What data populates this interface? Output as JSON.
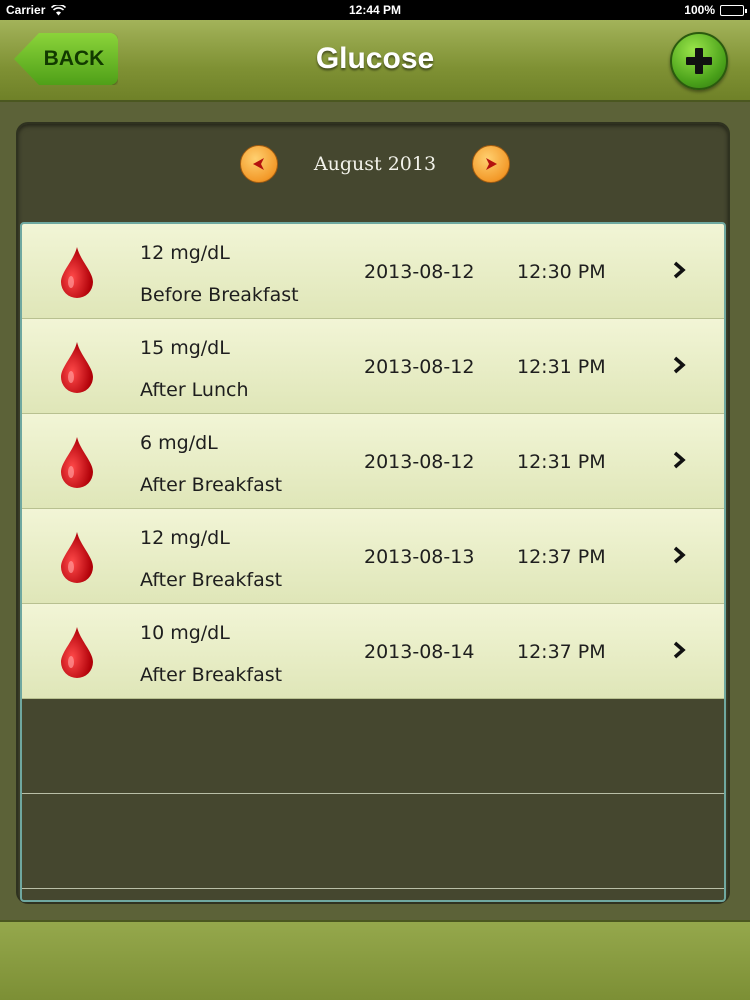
{
  "status_bar": {
    "carrier": "Carrier",
    "time": "12:44 PM",
    "battery": "100%"
  },
  "nav": {
    "back_label": "BACK",
    "title": "Glucose",
    "add_icon": "plus-icon"
  },
  "month_nav": {
    "label": "August 2013",
    "prev_icon": "arrow-left-icon",
    "next_icon": "arrow-right-icon"
  },
  "colors": {
    "drop": "#e0161c",
    "accent_green": "#5aa91e",
    "arrow_orange": "#f39a2a"
  },
  "entries": [
    {
      "value": "12 mg/dL",
      "meal": "Before Breakfast",
      "date": "2013-08-12",
      "time": "12:30 PM"
    },
    {
      "value": "15 mg/dL",
      "meal": "After Lunch",
      "date": "2013-08-12",
      "time": "12:31 PM"
    },
    {
      "value": "6 mg/dL",
      "meal": "After Breakfast",
      "date": "2013-08-12",
      "time": "12:31 PM"
    },
    {
      "value": "12 mg/dL",
      "meal": "After Breakfast",
      "date": "2013-08-13",
      "time": "12:37 PM"
    },
    {
      "value": "10 mg/dL",
      "meal": "After Breakfast",
      "date": "2013-08-14",
      "time": "12:37 PM"
    }
  ]
}
